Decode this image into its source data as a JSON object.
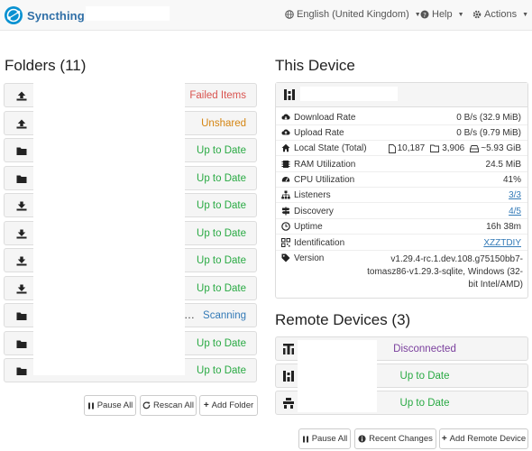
{
  "navbar": {
    "brand": "Syncthing",
    "language": "English (United Kingdom)",
    "help": "Help",
    "actions": "Actions"
  },
  "folders": {
    "title": "Folders (11)",
    "rows": [
      {
        "icon": "upload-icon",
        "status": "Failed Items",
        "status_class": "failed"
      },
      {
        "icon": "upload-icon",
        "status": "Unshared",
        "status_class": "unshared"
      },
      {
        "icon": "folder-icon",
        "status": "Up to Date",
        "status_class": "ok"
      },
      {
        "icon": "folder-icon",
        "status": "Up to Date",
        "status_class": "ok"
      },
      {
        "icon": "download-icon",
        "status": "Up to Date",
        "status_class": "ok"
      },
      {
        "icon": "download-icon",
        "status": "Up to Date",
        "status_class": "ok"
      },
      {
        "icon": "download-icon",
        "status": "Up to Date",
        "status_class": "ok"
      },
      {
        "icon": "download-icon",
        "status": "Up to Date",
        "status_class": "ok"
      },
      {
        "icon": "folder-icon",
        "status": "Scanning",
        "status_class": "scan"
      },
      {
        "icon": "folder-icon",
        "status": "Up to Date",
        "status_class": "ok"
      },
      {
        "icon": "folder-icon",
        "status": "Up to Date",
        "status_class": "ok"
      }
    ],
    "scanning_ellipsis": "…",
    "buttons": {
      "pause_all": "Pause All",
      "rescan_all": "Rescan All",
      "add_folder": "Add Folder"
    }
  },
  "this_device": {
    "title": "This Device",
    "download_rate": {
      "label": "Download Rate",
      "value": "0 B/s (32.9 MiB)"
    },
    "upload_rate": {
      "label": "Upload Rate",
      "value": "0 B/s (9.79 MiB)"
    },
    "local_state": {
      "label": "Local State (Total)",
      "files": "10,187",
      "dirs": "3,906",
      "size": "~5.93 GiB"
    },
    "ram": {
      "label": "RAM Utilization",
      "value": "24.5 MiB"
    },
    "cpu": {
      "label": "CPU Utilization",
      "value": "41%"
    },
    "listeners": {
      "label": "Listeners",
      "value": "3/3"
    },
    "discovery": {
      "label": "Discovery",
      "value": "4/5"
    },
    "uptime": {
      "label": "Uptime",
      "value": "16h 38m"
    },
    "identification": {
      "label": "Identification",
      "value": "XZZTDIY"
    },
    "version": {
      "label": "Version",
      "value": "v1.29.4-rc.1.dev.108.g75150bb7-tomasz86-v1.29.3-sqlite, Windows (32-bit Intel/AMD)"
    }
  },
  "remote_devices": {
    "title": "Remote Devices (3)",
    "rows": [
      {
        "status": "Disconnected",
        "status_class": "disc"
      },
      {
        "status": "Up to Date",
        "status_class": "ok"
      },
      {
        "status": "Up to Date",
        "status_class": "ok"
      }
    ],
    "buttons": {
      "pause_all": "Pause All",
      "recent_changes": "Recent Changes",
      "add_remote_device": "Add Remote Device"
    }
  }
}
